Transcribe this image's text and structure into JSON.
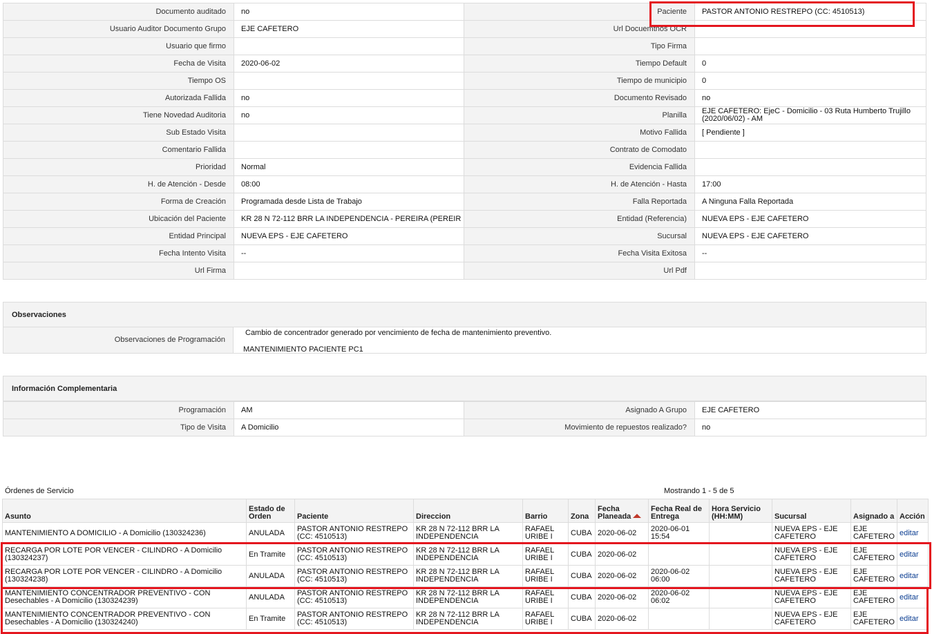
{
  "detail_rows": [
    {
      "l1": "Documento auditado",
      "v1": "no",
      "l2": "Paciente",
      "v2": "PASTOR ANTONIO RESTREPO (CC: 4510513)"
    },
    {
      "l1": "Usuario Auditor Documento Grupo",
      "v1": "EJE CAFETERO",
      "l2": "Url Docuemtnos OCR",
      "v2": ""
    },
    {
      "l1": "Usuario que firmo",
      "v1": "",
      "l2": "Tipo Firma",
      "v2": ""
    },
    {
      "l1": "Fecha de Visita",
      "v1": "2020-06-02",
      "l2": "Tiempo Default",
      "v2": "0"
    },
    {
      "l1": "Tiempo OS",
      "v1": "",
      "l2": "Tiempo de municipio",
      "v2": "0"
    },
    {
      "l1": "Autorizada Fallida",
      "v1": "no",
      "l2": "Documento Revisado",
      "v2": "no"
    },
    {
      "l1": "Tiene Novedad Auditoria",
      "v1": "no",
      "l2": "Planilla",
      "v2": "EJE CAFETERO: EjeC - Domicilio - 03 Ruta Humberto Trujillo (2020/06/02) - AM"
    },
    {
      "l1": "Sub Estado Visita",
      "v1": "",
      "l2": "Motivo Fallida",
      "v2": "[ Pendiente ]"
    },
    {
      "l1": "Comentario Fallida",
      "v1": "",
      "l2": "Contrato de Comodato",
      "v2": ""
    },
    {
      "l1": "Prioridad",
      "v1": "Normal",
      "l2": "Evidencia Fallida",
      "v2": ""
    },
    {
      "l1": "H. de Atención - Desde",
      "v1": "08:00",
      "l2": "H. de Atención - Hasta",
      "v2": "17:00"
    },
    {
      "l1": "Forma de Creación",
      "v1": "Programada desde Lista de Trabajo",
      "l2": "Falla Reportada",
      "v2": "A Ninguna Falla Reportada"
    },
    {
      "l1": "Ubicación del Paciente",
      "v1": "KR 28 N 72-112 BRR LA INDEPENDENCIA - PEREIRA (PEREIR",
      "l2": "Entidad (Referencia)",
      "v2": "NUEVA EPS - EJE CAFETERO"
    },
    {
      "l1": "Entidad Principal",
      "v1": "NUEVA EPS - EJE CAFETERO",
      "l2": "Sucursal",
      "v2": "NUEVA EPS - EJE CAFETERO"
    },
    {
      "l1": "Fecha Intento Visita",
      "v1": "--",
      "l2": "Fecha Visita Exitosa",
      "v2": "--"
    },
    {
      "l1": "Url Firma",
      "v1": "",
      "l2": "Url Pdf",
      "v2": ""
    }
  ],
  "observaciones": {
    "title": "Observaciones",
    "label": "Observaciones de Programación",
    "line1": "Cambio de concentrador generado por vencimiento de fecha de mantenimiento preventivo.",
    "line2": "MANTENIMIENTO PACIENTE PC1"
  },
  "complementaria": {
    "title": "Información Complementaria",
    "rows": [
      {
        "l1": "Programación",
        "v1": "AM",
        "l2": "Asignado A Grupo",
        "v2": "EJE CAFETERO"
      },
      {
        "l1": "Tipo de Visita",
        "v1": "A Domicilio",
        "l2": "Movimiento de repuestos realizado?",
        "v2": "no"
      }
    ]
  },
  "orders": {
    "title": "Órdenes de Servicio",
    "count": "Mostrando 1 - 5 de 5",
    "headers": [
      "Asunto",
      "Estado de Orden",
      "Paciente",
      "Direccion",
      "Barrio",
      "Zona",
      "Fecha Planeada",
      "Fecha Real de Entrega",
      "Hora Servicio (HH:MM)",
      "Sucursal",
      "Asignado a",
      "Acción"
    ],
    "rows": [
      {
        "asunto": "MANTENIMIENTO A DOMICILIO - A Domicilio (130324236)",
        "estado": "ANULADA",
        "paciente": "PASTOR ANTONIO RESTREPO (CC: 4510513)",
        "direccion": "KR 28 N 72-112 BRR LA INDEPENDENCIA",
        "barrio": "RAFAEL URIBE I",
        "zona": "CUBA",
        "fecha": "2020-06-02",
        "real": "2020-06-01 15:54",
        "hora": "",
        "sucursal": "NUEVA EPS - EJE CAFETERO",
        "asignado": "EJE CAFETERO",
        "accion": "editar"
      },
      {
        "asunto": "RECARGA POR LOTE POR VENCER - CILINDRO - A Domicilio (130324237)",
        "estado": "En Tramite",
        "paciente": "PASTOR ANTONIO RESTREPO (CC: 4510513)",
        "direccion": "KR 28 N 72-112 BRR LA INDEPENDENCIA",
        "barrio": "RAFAEL URIBE I",
        "zona": "CUBA",
        "fecha": "2020-06-02",
        "real": "",
        "hora": "",
        "sucursal": "NUEVA EPS - EJE CAFETERO",
        "asignado": "EJE CAFETERO",
        "accion": "editar"
      },
      {
        "asunto": "RECARGA POR LOTE POR VENCER - CILINDRO - A Domicilio (130324238)",
        "estado": "ANULADA",
        "paciente": "PASTOR ANTONIO RESTREPO (CC: 4510513)",
        "direccion": "KR 28 N 72-112 BRR LA INDEPENDENCIA",
        "barrio": "RAFAEL URIBE I",
        "zona": "CUBA",
        "fecha": "2020-06-02",
        "real": "2020-06-02 06:00",
        "hora": "",
        "sucursal": "NUEVA EPS - EJE CAFETERO",
        "asignado": "EJE CAFETERO",
        "accion": "editar"
      },
      {
        "asunto": "MANTENIMIENTO CONCENTRADOR PREVENTIVO - CON Desechables - A Domicilio (130324239)",
        "estado": "ANULADA",
        "paciente": "PASTOR ANTONIO RESTREPO (CC: 4510513)",
        "direccion": "KR 28 N 72-112 BRR LA INDEPENDENCIA",
        "barrio": "RAFAEL URIBE I",
        "zona": "CUBA",
        "fecha": "2020-06-02",
        "real": "2020-06-02 06:02",
        "hora": "",
        "sucursal": "NUEVA EPS - EJE CAFETERO",
        "asignado": "EJE CAFETERO",
        "accion": "editar"
      },
      {
        "asunto": "MANTENIMIENTO CONCENTRADOR PREVENTIVO - CON Desechables - A Domicilio (130324240)",
        "estado": "En Tramite",
        "paciente": "PASTOR ANTONIO RESTREPO (CC: 4510513)",
        "direccion": "KR 28 N 72-112 BRR LA INDEPENDENCIA",
        "barrio": "RAFAEL URIBE I",
        "zona": "CUBA",
        "fecha": "2020-06-02",
        "real": "",
        "hora": "",
        "sucursal": "NUEVA EPS - EJE CAFETERO",
        "asignado": "EJE CAFETERO",
        "accion": "editar"
      }
    ]
  },
  "colors": {
    "highlight": "#e4161e",
    "label_bg": "#f3f3f3",
    "border": "#dcdcdc",
    "link": "#0b3d91"
  }
}
